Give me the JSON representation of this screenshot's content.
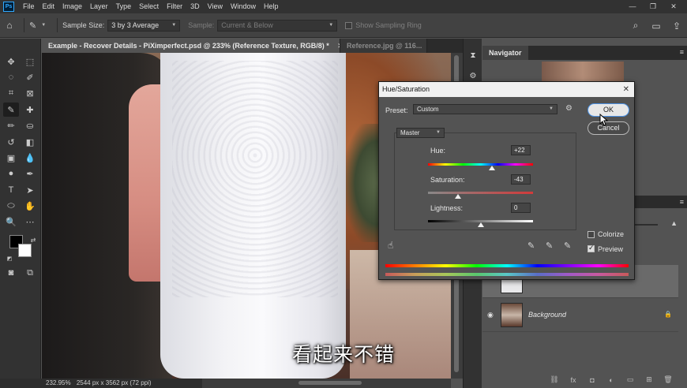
{
  "app": {
    "logo": "Ps",
    "menus": [
      "File",
      "Edit",
      "Image",
      "Layer",
      "Type",
      "Select",
      "Filter",
      "3D",
      "View",
      "Window",
      "Help"
    ],
    "window_controls": [
      "—",
      "❐",
      "✕"
    ]
  },
  "options_bar": {
    "sample_size_label": "Sample Size:",
    "sample_size_value": "3 by 3 Average",
    "sample_label": "Sample:",
    "sample_value": "Current & Below",
    "show_ring_label": "Show Sampling Ring"
  },
  "tabs": [
    {
      "label": "Example - Recover Details - PiXimperfect.psd @ 233% (Reference Texture, RGB/8) *",
      "close": "✕"
    },
    {
      "label": "Reference.jpg @ 116...",
      "close": ""
    }
  ],
  "canvas": {
    "subtitle": "看起来不错"
  },
  "status": {
    "zoom": "232.95%",
    "doc_info": "2544 px x 3562 px (72 ppi)"
  },
  "navigator": {
    "title": "Navigator"
  },
  "layers": {
    "background_name": "Background"
  },
  "dialog": {
    "title": "Hue/Saturation",
    "close": "✕",
    "preset_label": "Preset:",
    "preset_value": "Custom",
    "channel_value": "Master",
    "hue_label": "Hue:",
    "hue_value": "+22",
    "saturation_label": "Saturation:",
    "saturation_value": "-43",
    "lightness_label": "Lightness:",
    "lightness_value": "0",
    "ok_label": "OK",
    "cancel_label": "Cancel",
    "colorize_label": "Colorize",
    "colorize_checked": false,
    "preview_label": "Preview",
    "preview_checked": true,
    "hue_slider_fraction": 0.61,
    "saturation_slider_fraction": 0.285,
    "lightness_slider_fraction": 0.5
  },
  "colors": {
    "ui_dark": "#323232",
    "ui_mid": "#535353",
    "accent_blue": "#31a8ff",
    "foreground_color": "#000000",
    "background_color": "#ffffff"
  }
}
